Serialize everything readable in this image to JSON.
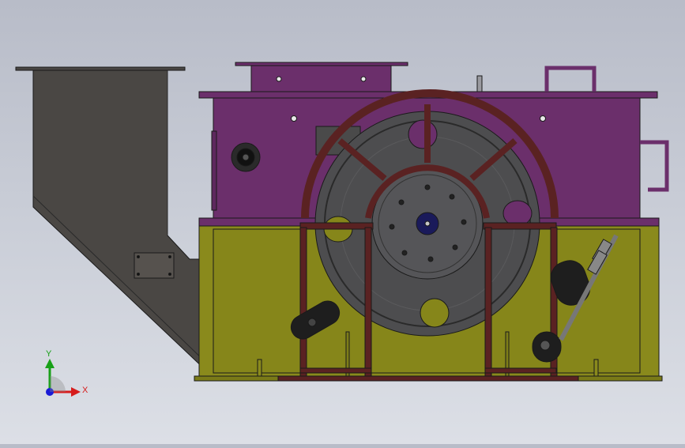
{
  "viewport": {
    "background_top": "#b8bcc8",
    "background_bottom": "#dcdfe6",
    "model": {
      "colors": {
        "hopper": "#4a4744",
        "upper_housing": "#6b2f6b",
        "lower_base": "#8a8a1c",
        "frame": "#5a2222",
        "wheel": "#4d4d4f",
        "hub": "#555558",
        "outline": "#1a1a1a"
      }
    }
  },
  "triad": {
    "x_label": "X",
    "y_label": "Y",
    "x_color": "#d61c1c",
    "y_color": "#18a018",
    "z_color": "#1a1ad6",
    "icon": "coordinate-triad-icon"
  }
}
